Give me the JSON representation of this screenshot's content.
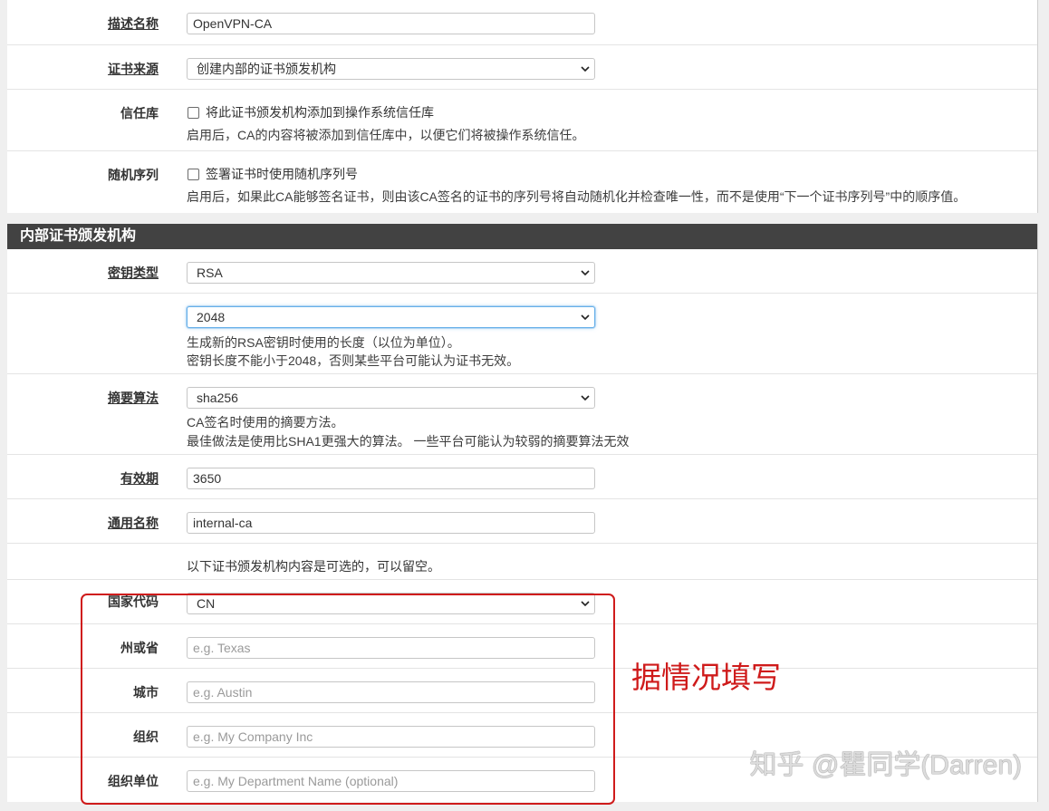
{
  "general": {
    "description": {
      "label": "描述名称",
      "value": "OpenVPN-CA"
    },
    "method": {
      "label": "证书来源",
      "value": "创建内部的证书颁发机构"
    },
    "trust": {
      "label": "信任库",
      "checkbox_label": "将此证书颁发机构添加到操作系统信任库",
      "checked": false,
      "help": "启用后，CA的内容将被添加到信任库中，以便它们将被操作系统信任。"
    },
    "random_serial": {
      "label": "随机序列",
      "checkbox_label": "签署证书时使用随机序列号",
      "checked": false,
      "help": "启用后，如果此CA能够签名证书，则由该CA签名的证书的序列号将自动随机化并检查唯一性，而不是使用“下一个证书序列号”中的顺序值。"
    }
  },
  "internal_ca": {
    "section_title": "内部证书颁发机构",
    "key_type": {
      "label": "密钥类型",
      "value": "RSA"
    },
    "key_length": {
      "value": "2048",
      "help": [
        "生成新的RSA密钥时使用的长度（以位为单位）。",
        "密钥长度不能小于2048，否则某些平台可能认为证书无效。"
      ]
    },
    "digest": {
      "label": "摘要算法",
      "value": "sha256",
      "help": [
        "CA签名时使用的摘要方法。",
        "最佳做法是使用比SHA1更强大的算法。 一些平台可能认为较弱的摘要算法无效"
      ]
    },
    "lifetime": {
      "label": "有效期",
      "value": "3650"
    },
    "common_name": {
      "label": "通用名称",
      "value": "internal-ca"
    },
    "optional_note": "以下证书颁发机构内容是可选的，可以留空。",
    "country": {
      "label": "国家代码",
      "value": "CN"
    },
    "state": {
      "label": "州或省",
      "placeholder": "e.g. Texas"
    },
    "city": {
      "label": "城市",
      "placeholder": "e.g. Austin"
    },
    "organization": {
      "label": "组织",
      "placeholder": "e.g. My Company Inc"
    },
    "org_unit": {
      "label": "组织单位",
      "placeholder": "e.g. My Department Name (optional)"
    }
  },
  "annotation": {
    "text": "据情况填写"
  },
  "watermark": {
    "text": "知乎 @瞿同学(Darren)"
  },
  "colors": {
    "page_bg": "#efefef",
    "section_header_bg": "#424242",
    "annotation_red": "#cf1b1b",
    "focus_border": "#66afe9",
    "placeholder": "#9a9a9a"
  }
}
